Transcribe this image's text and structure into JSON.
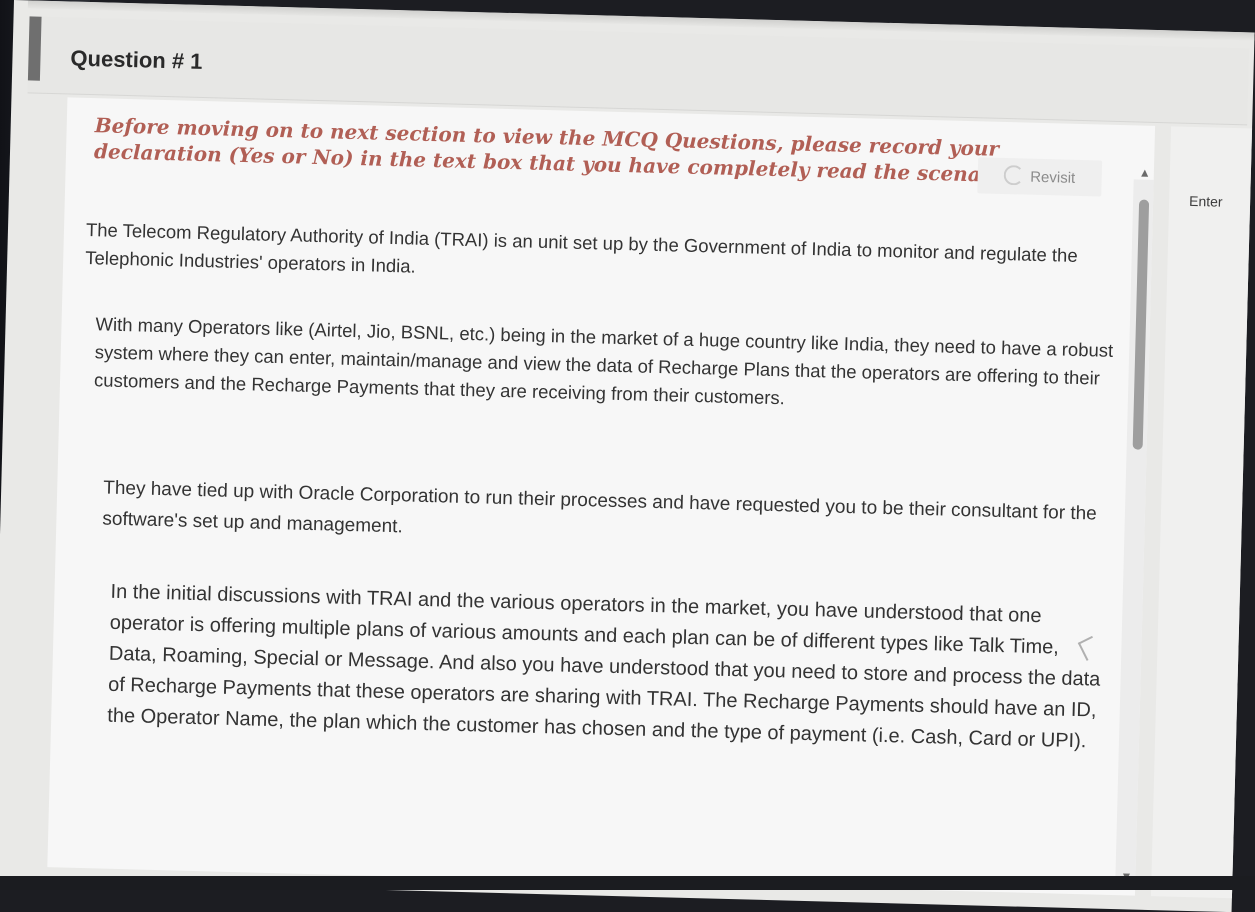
{
  "question": {
    "title": "Question # 1"
  },
  "declaration": "Before moving on to next section to view the MCQ Questions, please record your declaration (Yes or No) in the text box that you have completely read the scenario.",
  "revisit": {
    "label": "Revisit",
    "icon": "revisit-icon"
  },
  "scenario": {
    "p1": "The Telecom Regulatory Authority of India (TRAI) is an unit set up by the Government of India to monitor and regulate the Telephonic Industries' operators in India.",
    "p2": "With many Operators like (Airtel, Jio, BSNL, etc.) being in the market of a huge country like India, they need to have a robust system where they can enter, maintain/manage and view the data of Recharge Plans that the operators are offering to their customers and the Recharge Payments that they are receiving from their customers.",
    "p3": "They have tied up with Oracle Corporation to run their processes and have requested you to be their consultant for the software's set up and management.",
    "p4": "In the initial discussions with TRAI and the various operators in the market, you have understood that one operator is offering multiple plans of various amounts and each plan can be of different types like Talk Time, Data, Roaming, Special or Message. And also you have understood that you need to store and process the data of Recharge Payments that these operators are sharing with TRAI. The Recharge Payments should have an ID, the Operator Name, the plan which the customer has chosen and the type of payment (i.e. Cash, Card or UPI)."
  },
  "right_panel": {
    "label": "Enter"
  },
  "colors": {
    "declaration": "#b15f55",
    "body_text": "#333333",
    "background": "#e9e9e7"
  }
}
